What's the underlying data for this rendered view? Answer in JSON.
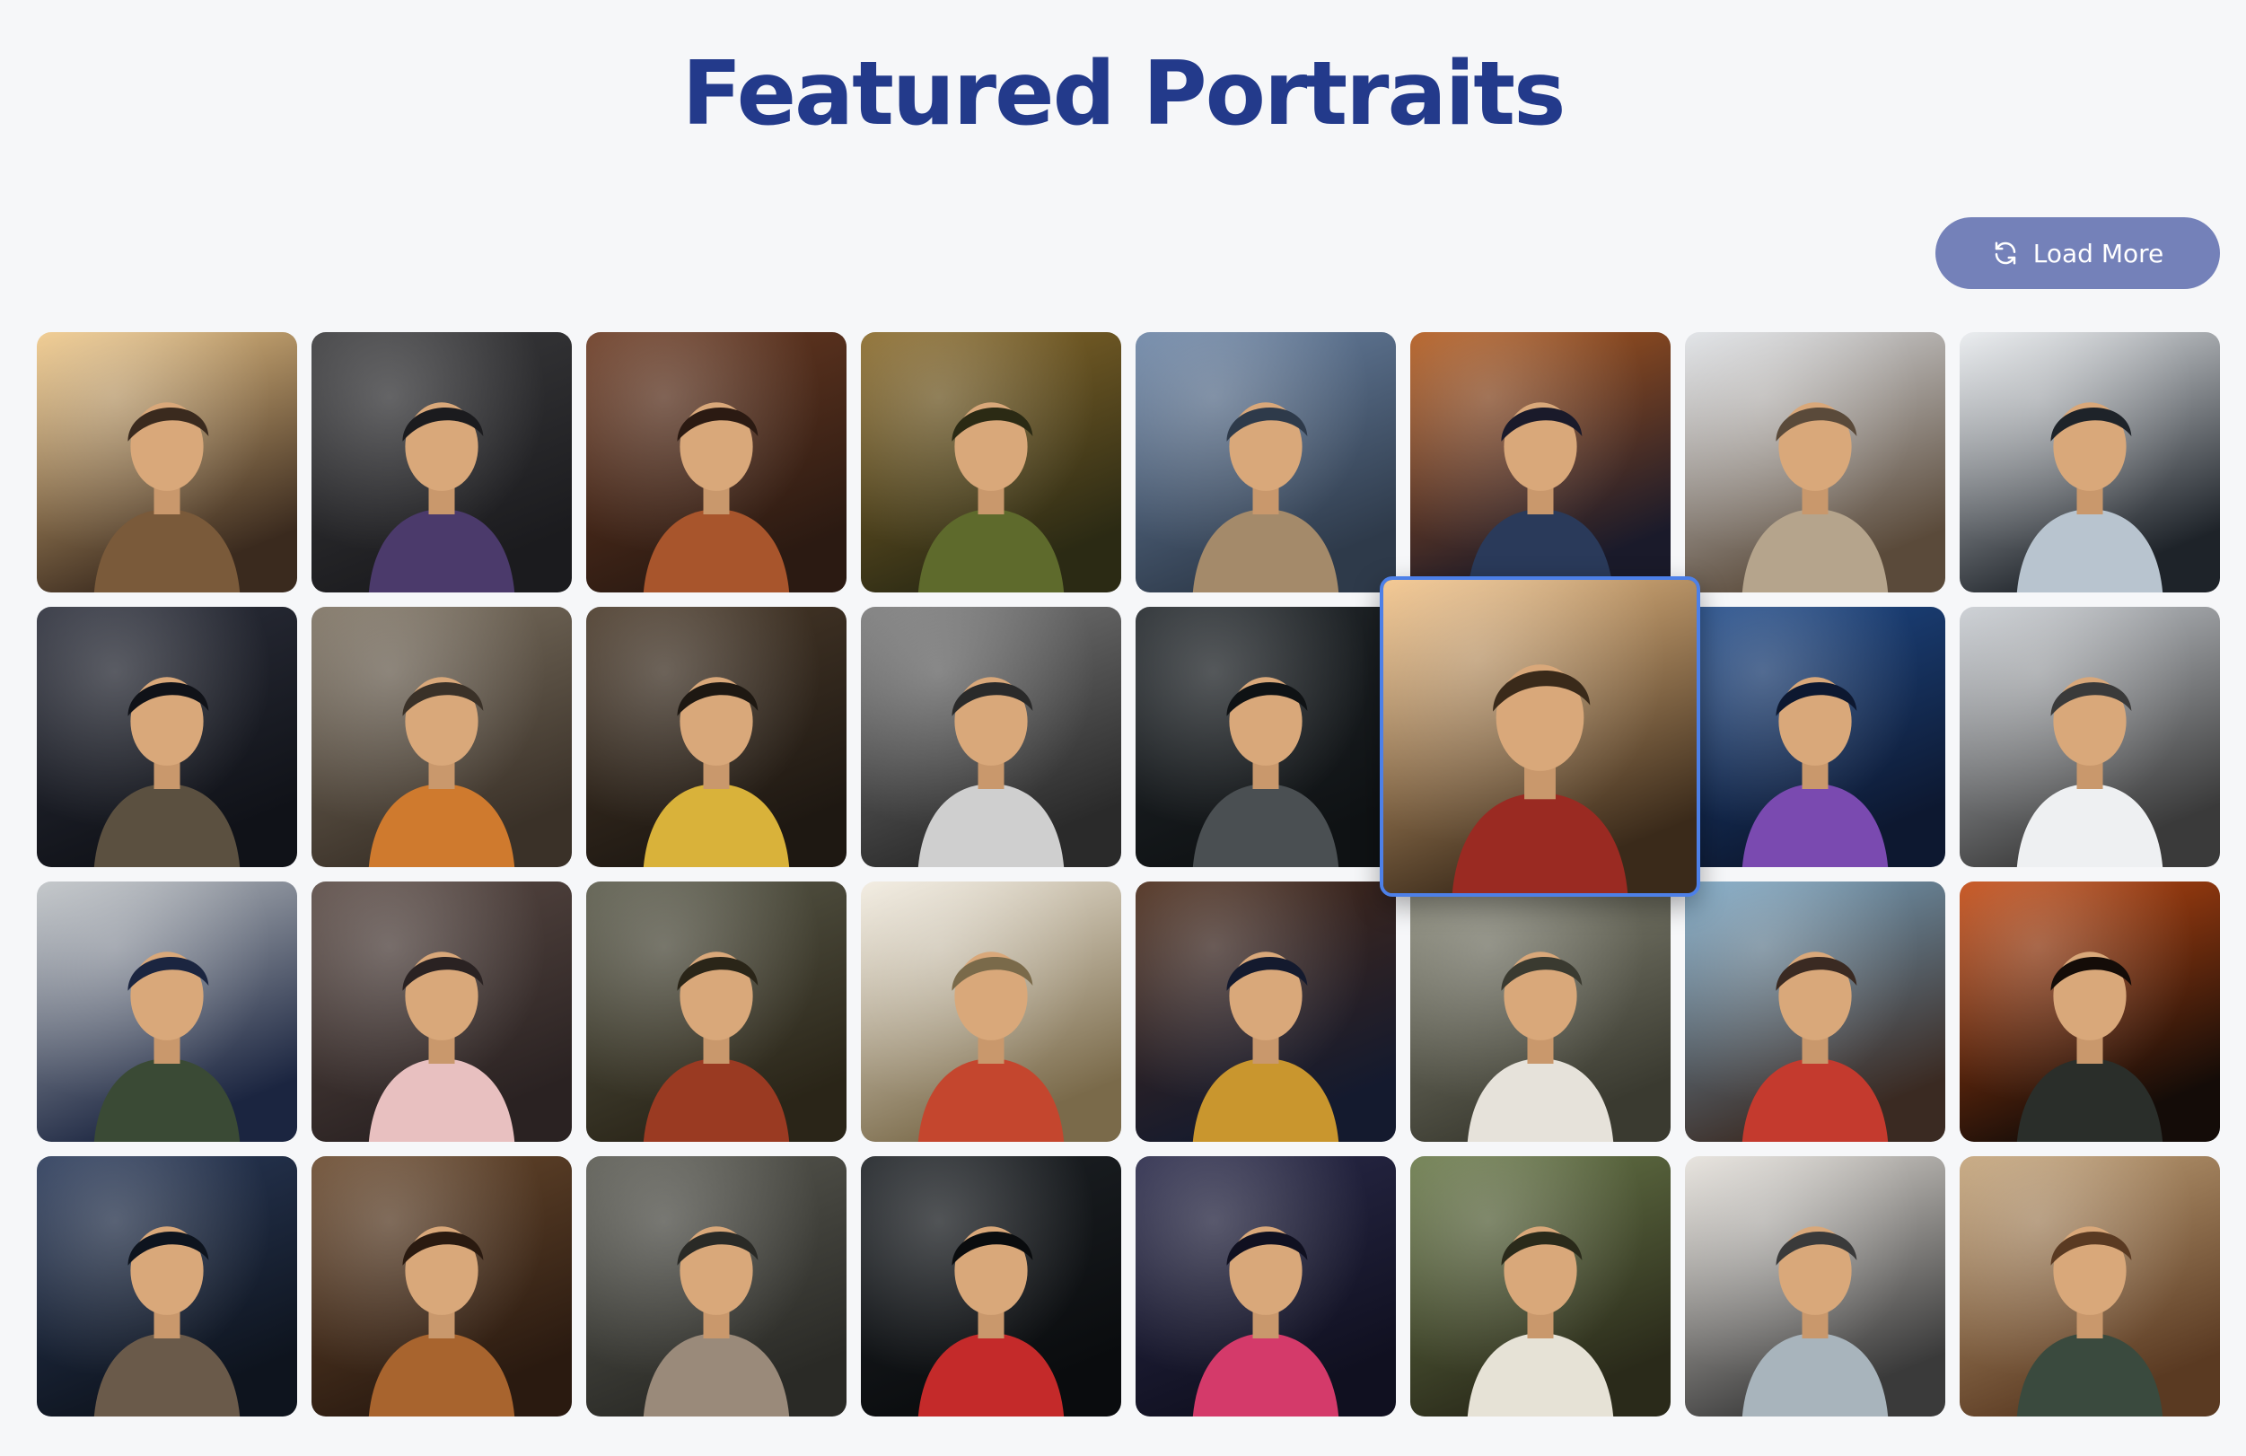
{
  "header": {
    "title": "Featured Portraits"
  },
  "toolbar": {
    "load_more_label": "Load More",
    "load_more_icon": "refresh-icon"
  },
  "gallery": {
    "rows": 4,
    "columns": 8,
    "highlighted_tile": 13,
    "tiles": [
      {
        "icon": "portrait-laughing-man-with-friends",
        "colors": [
          "#f0c98a",
          "#7a5a3a",
          "#3a2a1e"
        ]
      },
      {
        "icon": "portrait-joker-on-stairs",
        "colors": [
          "#3b3b3d",
          "#4b3a6b",
          "#1b1b1e"
        ]
      },
      {
        "icon": "portrait-warrior-youth",
        "colors": [
          "#6b3a22",
          "#a8552c",
          "#2b1a12"
        ]
      },
      {
        "icon": "portrait-fairy-in-forest",
        "colors": [
          "#8a6a2a",
          "#5e6a2c",
          "#2b2a14"
        ]
      },
      {
        "icon": "portrait-laughing-woman-with-bird",
        "colors": [
          "#6c85a6",
          "#a48a6a",
          "#2e3a4a"
        ]
      },
      {
        "icon": "portrait-robot-astronaut-girl",
        "colors": [
          "#b35a1c",
          "#2a3a5a",
          "#1a1a2a"
        ]
      },
      {
        "icon": "portrait-woman-white-dress-street",
        "colors": [
          "#dfe2e6",
          "#b5a48c",
          "#5a4a3a"
        ]
      },
      {
        "icon": "portrait-man-in-suit-helicopter",
        "colors": [
          "#e9ecef",
          "#b8c4cf",
          "#1e2329"
        ]
      },
      {
        "icon": "portrait-pianist-on-stage",
        "colors": [
          "#2c2f3b",
          "#5b5040",
          "#101218"
        ]
      },
      {
        "icon": "portrait-woman-construction-worker",
        "colors": [
          "#7d7262",
          "#cf7a2e",
          "#3a3128"
        ]
      },
      {
        "icon": "portrait-woman-yellow-shirt",
        "colors": [
          "#4a3a2a",
          "#d9b23a",
          "#1e1812"
        ]
      },
      {
        "icon": "portrait-pencil-sketch-man",
        "colors": [
          "#7a7a7a",
          "#cfcfcf",
          "#2a2a2a"
        ]
      },
      {
        "icon": "portrait-laughing-guitarist",
        "colors": [
          "#23282c",
          "#4a4f52",
          "#0f1214"
        ]
      },
      {
        "icon": "portrait-smiling-man-red-jacket",
        "colors": [
          "#f3c48a",
          "#9a2a22",
          "#3a2a1a"
        ]
      },
      {
        "icon": "portrait-neon-cyber-woman",
        "colors": [
          "#1e4a8a",
          "#7a4ab0",
          "#0d1830"
        ]
      },
      {
        "icon": "portrait-bride-with-horse",
        "colors": [
          "#c9cdd2",
          "#eef0f2",
          "#3a3a3a"
        ]
      },
      {
        "icon": "portrait-woman-blue-gown-field",
        "colors": [
          "#bfc3c6",
          "#3a4a35",
          "#1b2540"
        ]
      },
      {
        "icon": "portrait-singer-with-microphone",
        "colors": [
          "#5a4a44",
          "#e8c0c0",
          "#2a2222"
        ]
      },
      {
        "icon": "portrait-knight-on-horse",
        "colors": [
          "#5a5a4a",
          "#9a3a22",
          "#2a2518"
        ]
      },
      {
        "icon": "portrait-wolf-hiker-mountain",
        "colors": [
          "#f2ece0",
          "#c4462e",
          "#7a6a4a"
        ]
      },
      {
        "icon": "portrait-man-sunglasses-temple",
        "colors": [
          "#4a2a18",
          "#c9962e",
          "#141a2e"
        ]
      },
      {
        "icon": "portrait-smiling-man-white-suit",
        "colors": [
          "#8a8a7a",
          "#e6e2da",
          "#3a3a30"
        ]
      },
      {
        "icon": "portrait-curly-woman-beach",
        "colors": [
          "#7aa6c4",
          "#c43a2e",
          "#3a2a22"
        ]
      },
      {
        "icon": "portrait-firefighter",
        "colors": [
          "#c44a12",
          "#2a2e2a",
          "#140c08"
        ]
      },
      {
        "icon": "portrait-woman-airship-cockpit",
        "colors": [
          "#2a3a5a",
          "#6a5a4a",
          "#0e141e"
        ]
      },
      {
        "icon": "portrait-warrior-woman",
        "colors": [
          "#6a4a2e",
          "#a8642e",
          "#2a1a10"
        ]
      },
      {
        "icon": "portrait-street-youths",
        "colors": [
          "#5a5a52",
          "#9a8a7a",
          "#2a2a26"
        ]
      },
      {
        "icon": "portrait-boy-with-headphones",
        "colors": [
          "#1e2226",
          "#c42a2a",
          "#0a0c0e"
        ]
      },
      {
        "icon": "portrait-man-peace-sign-night-market",
        "colors": [
          "#2a2a4a",
          "#d43a6a",
          "#101020"
        ]
      },
      {
        "icon": "portrait-woman-with-lion",
        "colors": [
          "#6a7a4a",
          "#e6e2d6",
          "#2a2a1a"
        ]
      },
      {
        "icon": "portrait-man-white-suit-seagulls",
        "colors": [
          "#e6e2dc",
          "#a8b4bc",
          "#3a3a3a"
        ]
      },
      {
        "icon": "portrait-girl-chalkboard",
        "colors": [
          "#c4a47a",
          "#3a4a3e",
          "#5a3a22"
        ]
      }
    ]
  }
}
